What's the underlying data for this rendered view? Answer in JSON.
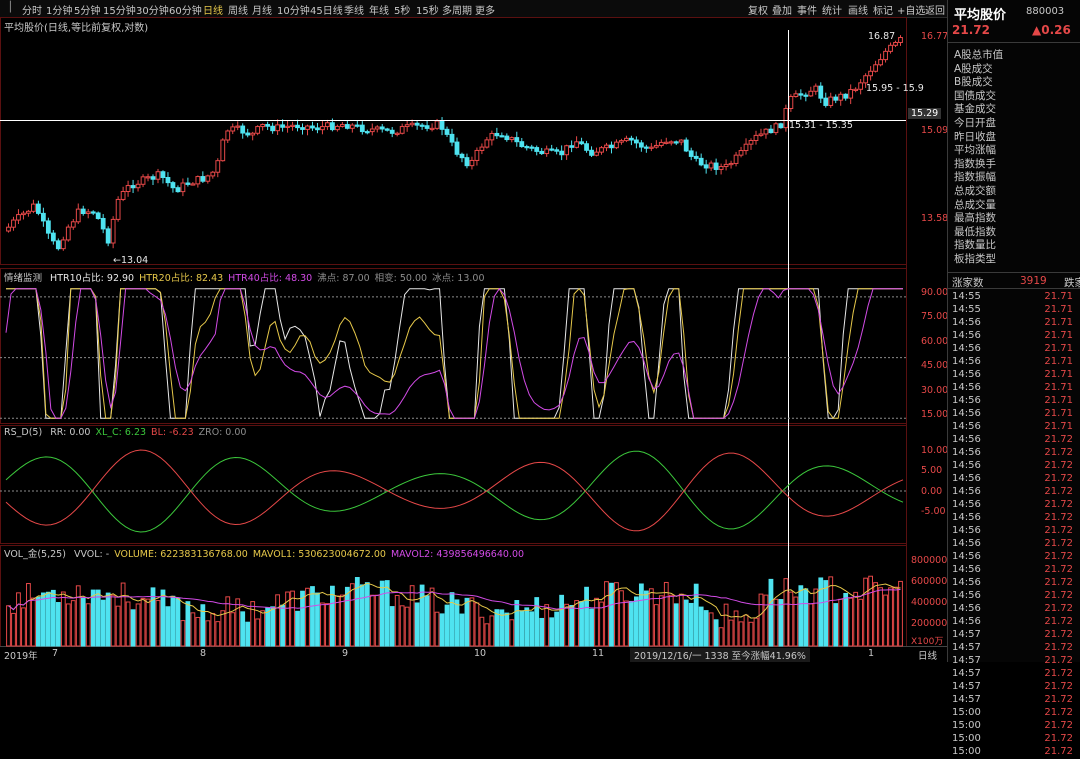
{
  "toolbar": {
    "periods": [
      "分时",
      "1分钟",
      "5分钟",
      "15分钟",
      "30分钟",
      "60分钟",
      "日线",
      "周线",
      "月线",
      "10分钟",
      "45日线",
      "季线",
      "年线",
      "5秒",
      "15秒",
      "多周期",
      "更多"
    ],
    "active": "日线",
    "right_tools": [
      "复权",
      "叠加",
      "事件",
      "统计",
      "画线",
      "标记",
      "+自选",
      "返回"
    ]
  },
  "main_panel": {
    "title": "平均股价(日线,等比前复权,对数)",
    "y_ticks": [
      "16.77",
      "15.09",
      "13.58"
    ],
    "crosshair_price": "15.29",
    "annotations": {
      "high": "16.87",
      "low": "13.04",
      "range1": "15.95 - 15.9",
      "range2": "15.31 - 15.35"
    }
  },
  "htr_panel": {
    "name": "情绪监测",
    "items": [
      {
        "label": "HTR10占比: 92.90",
        "color": "#e8e8e8"
      },
      {
        "label": "HTR20占比: 82.43",
        "color": "#e6c84a"
      },
      {
        "label": "HTR40占比: 48.30",
        "color": "#d24be6"
      },
      {
        "label": "沸点: 87.00",
        "color": "#8c8c8c"
      },
      {
        "label": "相变: 50.00",
        "color": "#8c8c8c"
      },
      {
        "label": "冰点: 13.00",
        "color": "#8c8c8c"
      }
    ],
    "y_ticks": [
      "90.00",
      "75.00",
      "60.00",
      "45.00",
      "30.00",
      "15.00"
    ]
  },
  "rsd_panel": {
    "name": "RS_D(5)",
    "items": [
      {
        "label": "RR: 0.00",
        "color": "#c8c8c8"
      },
      {
        "label": "XL_C: 6.23",
        "color": "#3cc83c"
      },
      {
        "label": "BL: -6.23",
        "color": "#e54848"
      },
      {
        "label": "ZRO: 0.00",
        "color": "#8c8c8c"
      }
    ],
    "y_ticks": [
      "10.00",
      "5.00",
      "0.00",
      "-5.00"
    ]
  },
  "vol_panel": {
    "name": "VOL_金(5,25)",
    "items": [
      {
        "label": "VVOL: -",
        "color": "#c8c8c8"
      },
      {
        "label": "VOLUME: 622383136768.00",
        "color": "#e6c84a"
      },
      {
        "label": "MAVOL1: 530623004672.00",
        "color": "#e6c84a"
      },
      {
        "label": "MAVOL2: 439856496640.00",
        "color": "#d24be6"
      }
    ],
    "y_ticks": [
      "800000",
      "600000",
      "400000",
      "200000"
    ],
    "unit": "X100万"
  },
  "x_axis": {
    "labels": [
      "2019年",
      "7",
      "8",
      "9",
      "10",
      "11",
      "1"
    ],
    "status": "2019/12/16/一 1338 至今涨幅41.96%",
    "period": "日线"
  },
  "right_panel": {
    "title": "平均股价",
    "code": "880003",
    "price": "21.72",
    "change": "▲0.26",
    "menu": [
      "A股总市值",
      "A股成交",
      "B股成交",
      "国债成交",
      "基金成交",
      "今日开盘",
      "昨日收盘",
      "平均涨幅",
      "指数换手",
      "指数振幅",
      "总成交额",
      "总成交量",
      "最高指数",
      "最低指数",
      "指数量比",
      "板指类型"
    ],
    "up_label": "涨家数",
    "up_count": "3919",
    "down_label": "跌家",
    "ticks": [
      {
        "t": "14:55",
        "p": "21.71"
      },
      {
        "t": "14:55",
        "p": "21.71"
      },
      {
        "t": "14:56",
        "p": "21.71"
      },
      {
        "t": "14:56",
        "p": "21.71"
      },
      {
        "t": "14:56",
        "p": "21.71"
      },
      {
        "t": "14:56",
        "p": "21.71"
      },
      {
        "t": "14:56",
        "p": "21.71"
      },
      {
        "t": "14:56",
        "p": "21.71"
      },
      {
        "t": "14:56",
        "p": "21.71"
      },
      {
        "t": "14:56",
        "p": "21.71"
      },
      {
        "t": "14:56",
        "p": "21.71"
      },
      {
        "t": "14:56",
        "p": "21.72"
      },
      {
        "t": "14:56",
        "p": "21.72"
      },
      {
        "t": "14:56",
        "p": "21.72"
      },
      {
        "t": "14:56",
        "p": "21.72"
      },
      {
        "t": "14:56",
        "p": "21.72"
      },
      {
        "t": "14:56",
        "p": "21.72"
      },
      {
        "t": "14:56",
        "p": "21.72"
      },
      {
        "t": "14:56",
        "p": "21.72"
      },
      {
        "t": "14:56",
        "p": "21.72"
      },
      {
        "t": "14:56",
        "p": "21.72"
      },
      {
        "t": "14:56",
        "p": "21.72"
      },
      {
        "t": "14:56",
        "p": "21.72"
      },
      {
        "t": "14:56",
        "p": "21.72"
      },
      {
        "t": "14:56",
        "p": "21.72"
      },
      {
        "t": "14:56",
        "p": "21.72"
      },
      {
        "t": "14:57",
        "p": "21.72"
      },
      {
        "t": "14:57",
        "p": "21.72"
      },
      {
        "t": "14:57",
        "p": "21.72"
      },
      {
        "t": "14:57",
        "p": "21.72"
      },
      {
        "t": "14:57",
        "p": "21.72"
      },
      {
        "t": "14:57",
        "p": "21.72"
      },
      {
        "t": "15:00",
        "p": "21.72"
      },
      {
        "t": "15:00",
        "p": "21.72"
      },
      {
        "t": "15:00",
        "p": "21.72"
      },
      {
        "t": "15:00",
        "p": "21.72"
      }
    ]
  },
  "colors": {
    "up": "#e54848",
    "down": "#4fe3f0",
    "crosshair": "#ffffff",
    "grid": "#8c8c8c"
  }
}
